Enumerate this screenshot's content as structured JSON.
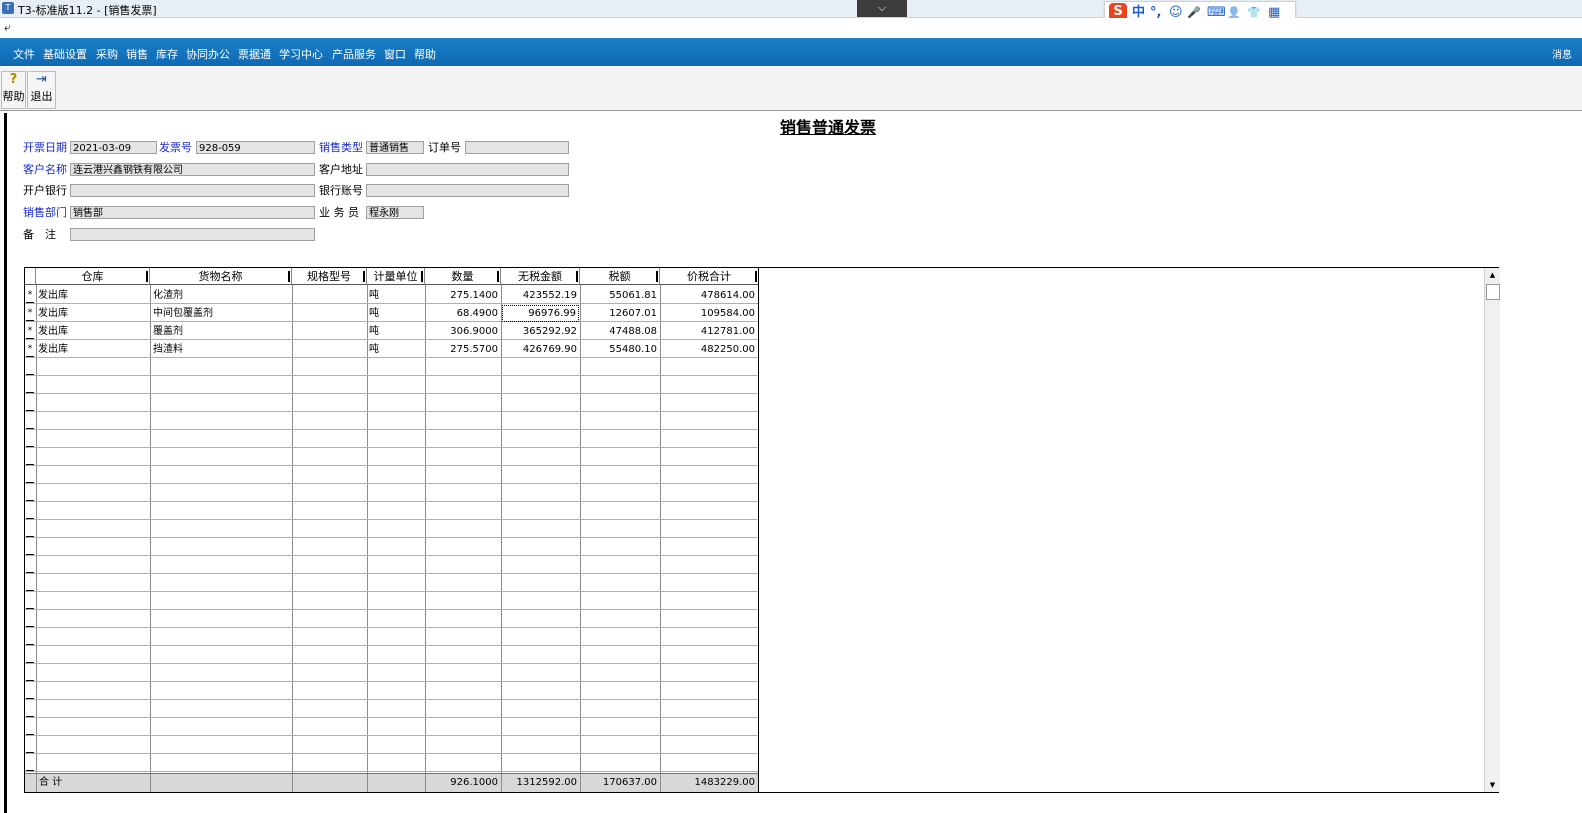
{
  "window": {
    "title": "T3-标准版11.2 - [销售发票]",
    "collapse_symbol": "⌵",
    "sub_symbol": "⤶"
  },
  "ime": {
    "logo": "S",
    "mode": "中",
    "punct": "°,",
    "emoji": "☺",
    "voice": "🎤",
    "keyboard": "⌨",
    "user": "👤",
    "skin": "👕",
    "grid": "▦"
  },
  "menu": [
    "文件",
    "基础设置",
    "采购",
    "销售",
    "库存",
    "协同办公",
    "票据通",
    "学习中心",
    "产品服务",
    "窗口",
    "帮助"
  ],
  "menu_right": "消息",
  "toolbar": {
    "help_label": "帮助",
    "help_icon": "?",
    "exit_label": "退出",
    "exit_icon": "⇥"
  },
  "doc": {
    "title": "销售普通发票",
    "labels": {
      "invoice_date": "开票日期",
      "invoice_no": "发票号",
      "sales_type": "销售类型",
      "order_no": "订单号",
      "customer_name": "客户名称",
      "customer_address": "客户地址",
      "bank": "开户银行",
      "bank_account": "银行账号",
      "sales_dept": "销售部门",
      "salesperson": "业 务 员",
      "remark": "备　注"
    },
    "values": {
      "invoice_date": "2021-03-09",
      "invoice_no": "928-059",
      "sales_type": "普通销售",
      "order_no": "",
      "customer_name": "连云港兴鑫钢铁有限公司",
      "customer_address": "",
      "bank": "",
      "bank_account": "",
      "sales_dept": "销售部",
      "salesperson": "程永刚",
      "remark": ""
    }
  },
  "grid": {
    "columns": [
      "仓库",
      "货物名称",
      "规格型号",
      "计量单位",
      "数量",
      "无税金额",
      "税额",
      "价税合计"
    ],
    "rows": [
      {
        "warehouse": "发出库",
        "goods": "化渣剂",
        "spec": "",
        "unit": "吨",
        "qty": "275.1400",
        "net": "423552.19",
        "tax": "55061.81",
        "total": "478614.00"
      },
      {
        "warehouse": "发出库",
        "goods": "中间包覆盖剂",
        "spec": "",
        "unit": "吨",
        "qty": "68.4900",
        "net": "96976.99",
        "tax": "12607.01",
        "total": "109584.00"
      },
      {
        "warehouse": "发出库",
        "goods": "覆盖剂",
        "spec": "",
        "unit": "吨",
        "qty": "306.9000",
        "net": "365292.92",
        "tax": "47488.08",
        "total": "412781.00"
      },
      {
        "warehouse": "发出库",
        "goods": "挡渣料",
        "spec": "",
        "unit": "吨",
        "qty": "275.5700",
        "net": "426769.90",
        "tax": "55480.10",
        "total": "482250.00"
      }
    ],
    "row_marker": "*",
    "total_label": "合  计",
    "totals": {
      "qty": "926.1000",
      "net": "1312592.00",
      "tax": "170637.00",
      "total": "1483229.00"
    }
  },
  "scroll": {
    "up": "▲",
    "down": "▼"
  },
  "colors": {
    "menu_bg": "#1275be",
    "label_blue": "#1a2ad0",
    "field_bg": "#e4e4e4"
  }
}
